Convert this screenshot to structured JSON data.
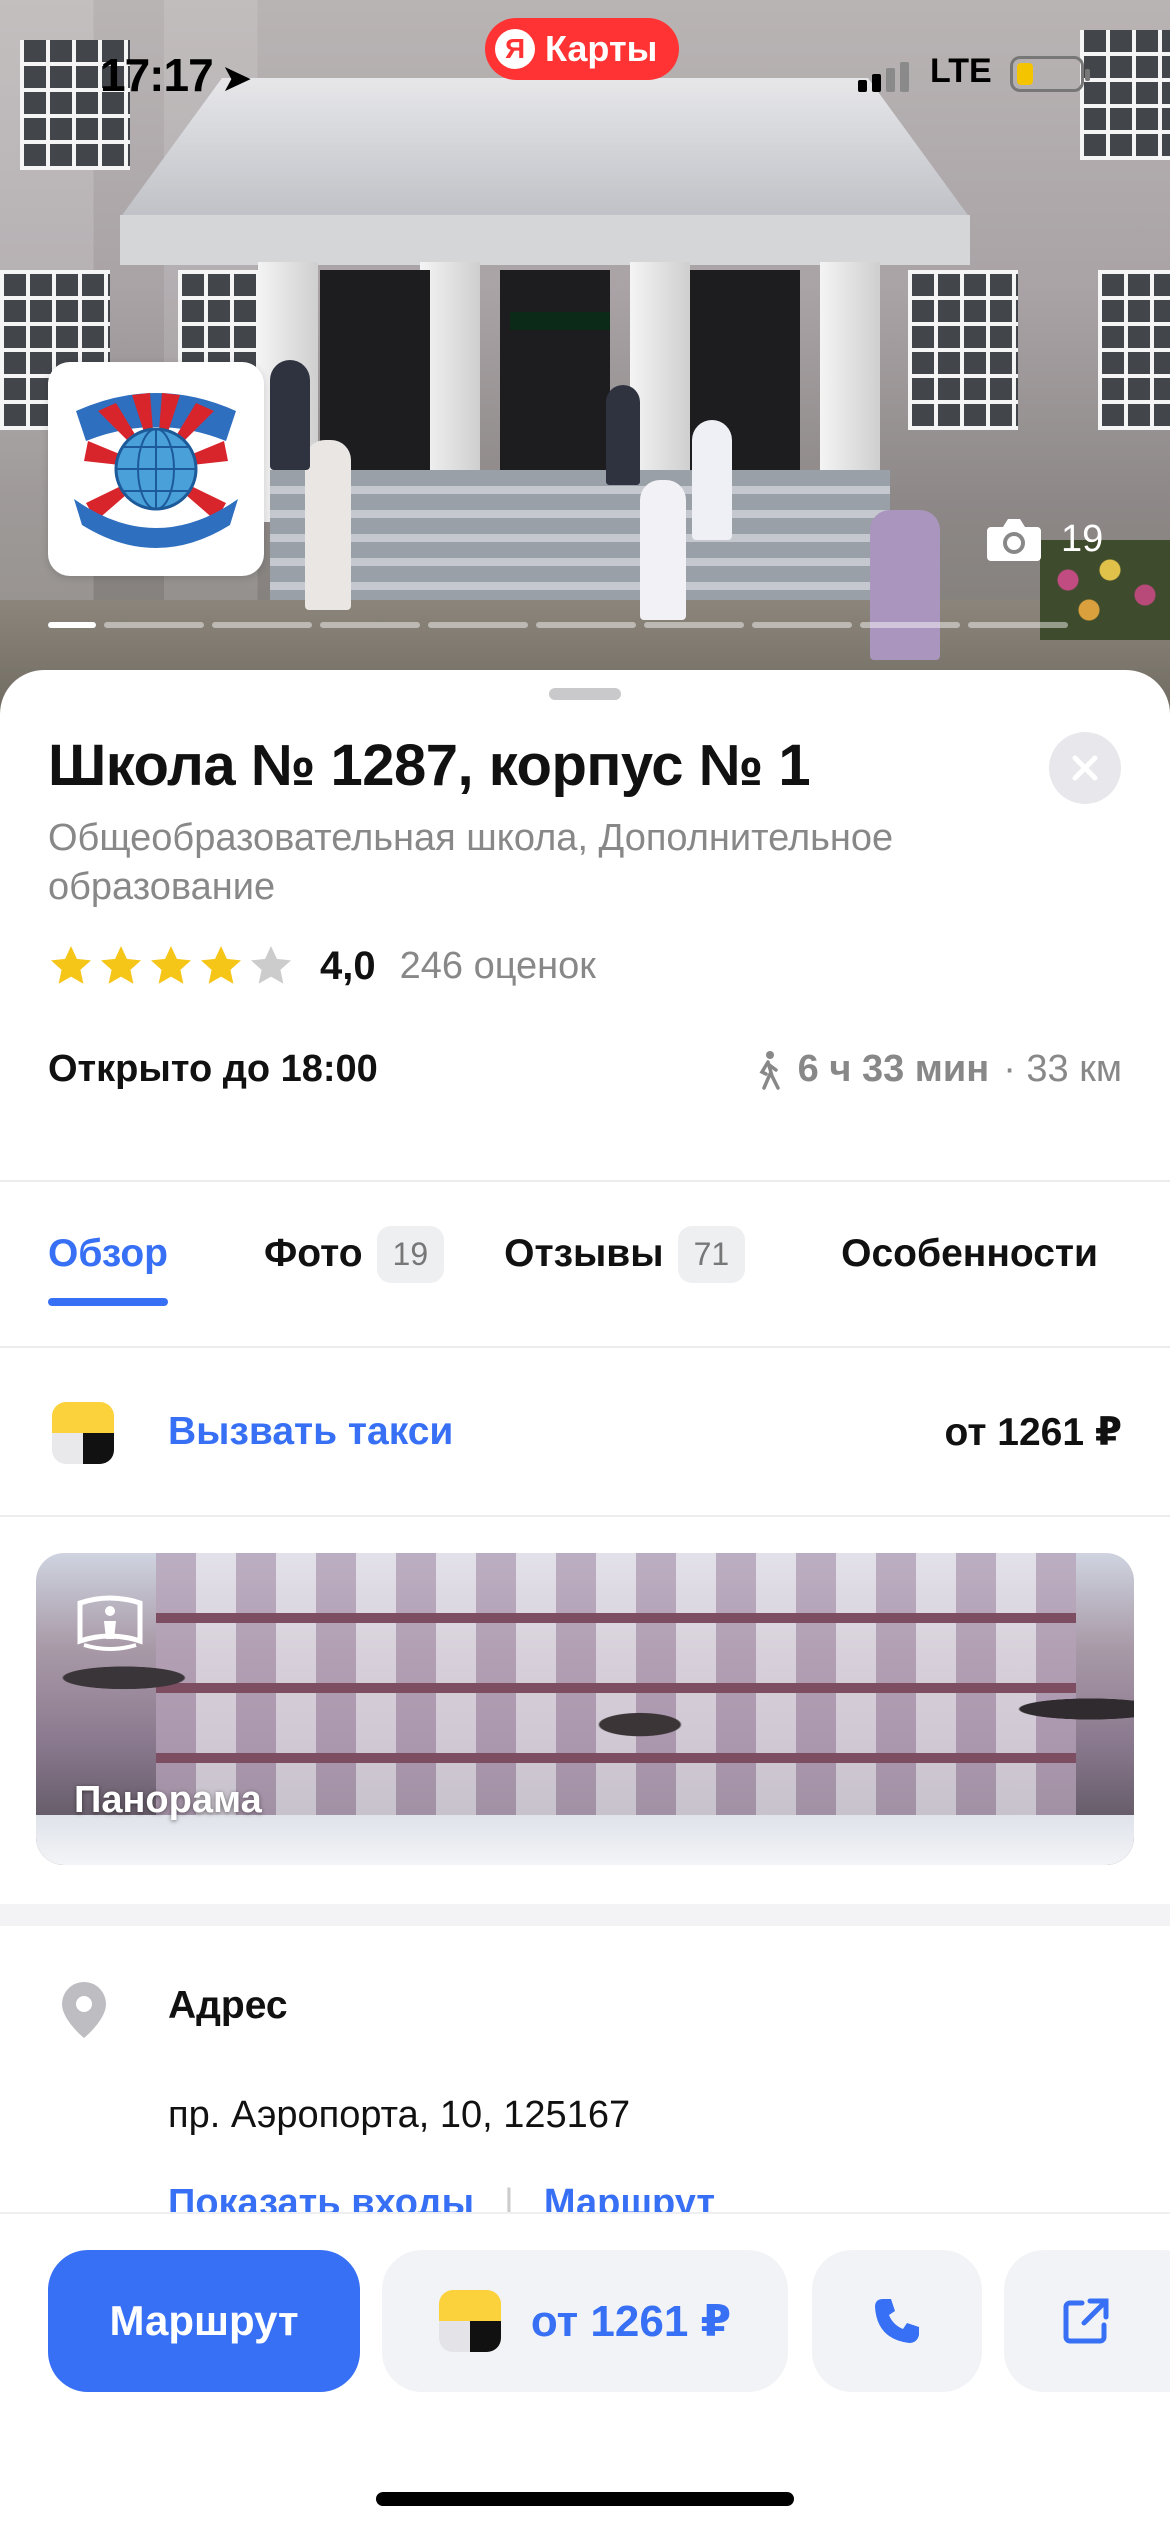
{
  "status_bar": {
    "time": "17:17",
    "network": "LTE",
    "app_badge": "Карты",
    "app_badge_logo": "Я"
  },
  "hero": {
    "photo_count": "19",
    "logo_alt": "ГБОУ Школа №1287 — Знания освещают мир"
  },
  "place": {
    "title": "Школа № 1287, корпус № 1",
    "category": "Общеобразовательная школа, Дополнительное образование",
    "rating_value": "4,0",
    "rating_stars": 4,
    "rating_count": "246 оценок",
    "open_status": "Открыто до 18:00",
    "travel_time": "6 ч 33 мин",
    "travel_distance": "· 33 км"
  },
  "tabs": [
    {
      "label": "Обзор",
      "count": ""
    },
    {
      "label": "Фото",
      "count": "19"
    },
    {
      "label": "Отзывы",
      "count": "71"
    },
    {
      "label": "Особенности",
      "count": ""
    }
  ],
  "taxi": {
    "label": "Вызвать такси",
    "price": "от 1261 ₽"
  },
  "panorama": {
    "label": "Панорама"
  },
  "address": {
    "title": "Адрес",
    "value": "пр. Аэропорта, 10,  125167",
    "link_entrances": "Показать входы",
    "link_separator": "|",
    "link_route": "Маршрут"
  },
  "bottom_bar": {
    "route_label": "Маршрут",
    "taxi_price": "от 1261 ₽"
  },
  "colors": {
    "accent": "#3770f5",
    "star": "#f5c518",
    "star_empty": "#cccccc",
    "taxi_yellow": "#fcd23c",
    "maps_red": "#ff3333"
  },
  "icons": [
    "location-arrow-icon",
    "battery-icon",
    "camera-icon",
    "close-icon",
    "star-icon",
    "walk-icon",
    "taxi-icon",
    "panorama-icon",
    "map-pin-icon",
    "phone-icon",
    "share-icon"
  ]
}
